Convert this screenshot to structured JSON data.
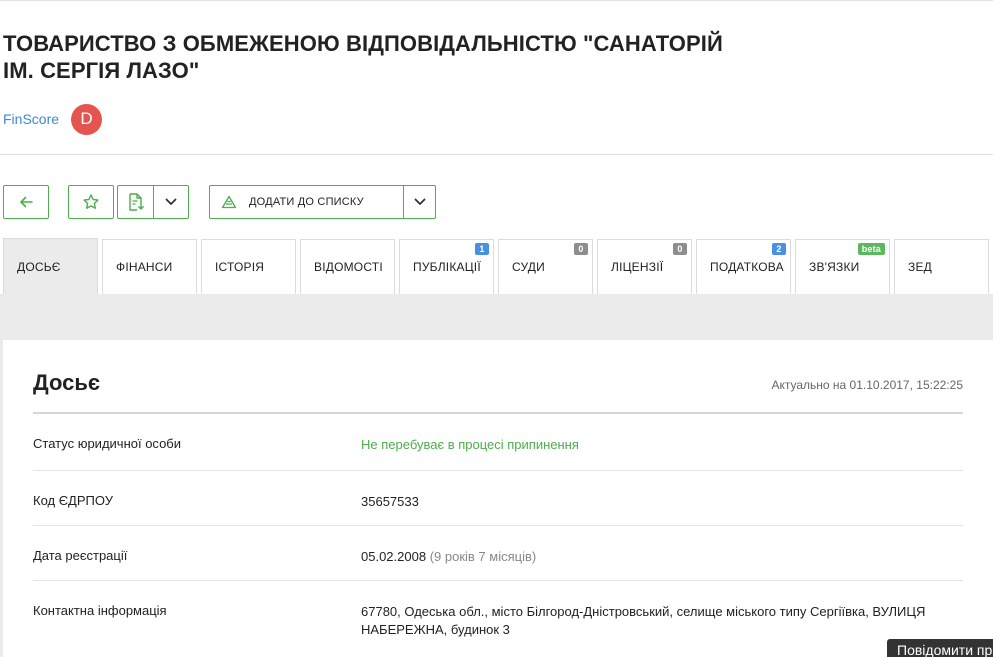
{
  "company": {
    "title": "ТОВАРИСТВО З ОБМЕЖЕНОЮ ВІДПОВІДАЛЬНІСТЮ \"САНАТОРІЙ ІМ. СЕРГІЯ ЛАЗО\"",
    "finscore_label": "FinScore",
    "finscore_grade": "D"
  },
  "colors": {
    "accent_green": "#4cae4c",
    "finscore_badge": "#e5554f",
    "link_blue": "#3a8ad6"
  },
  "toolbar": {
    "back_icon": "arrow-left-icon",
    "favorite_icon": "star-icon",
    "export_icon": "document-download-icon",
    "add_to_list_icon": "list-triangle-icon",
    "add_to_list_label": "ДОДАТИ ДО СПИСКУ"
  },
  "tabs": [
    {
      "label": "ДОСЬЄ",
      "badge": ""
    },
    {
      "label": "ФІНАНСИ",
      "badge": ""
    },
    {
      "label": "ІСТОРІЯ",
      "badge": ""
    },
    {
      "label": "ВІДОМОСТІ",
      "badge": ""
    },
    {
      "label": "ПУБЛІКАЦІЇ",
      "badge": "1"
    },
    {
      "label": "СУДИ",
      "badge": "0"
    },
    {
      "label": "ЛІЦЕНЗІЇ",
      "badge": "0"
    },
    {
      "label": "ПОДАТКОВА",
      "badge": "2"
    },
    {
      "label": "ЗВ'ЯЗКИ",
      "badge": "beta"
    },
    {
      "label": "ЗЕД",
      "badge": ""
    }
  ],
  "dossier": {
    "title": "Досьє",
    "updated": "Актуально на 01.10.2017, 15:22:25",
    "rows": [
      {
        "label": "Статус юридичної особи",
        "value": "Не перебуває в процесі припинення"
      },
      {
        "label": "Код ЄДРПОУ",
        "value": "35657533"
      },
      {
        "label": "Дата реєстрації",
        "value": "05.02.2008",
        "extra": "(9 років 7 місяців)"
      },
      {
        "label": "Контактна інформація",
        "value": "67780, Одеська обл., місто Білгород-Дністровський, селище міського типу Сергіївка, ВУЛИЦЯ НАБЕРЕЖНА, будинок 3"
      }
    ]
  },
  "report_button": "Повідомити пр"
}
